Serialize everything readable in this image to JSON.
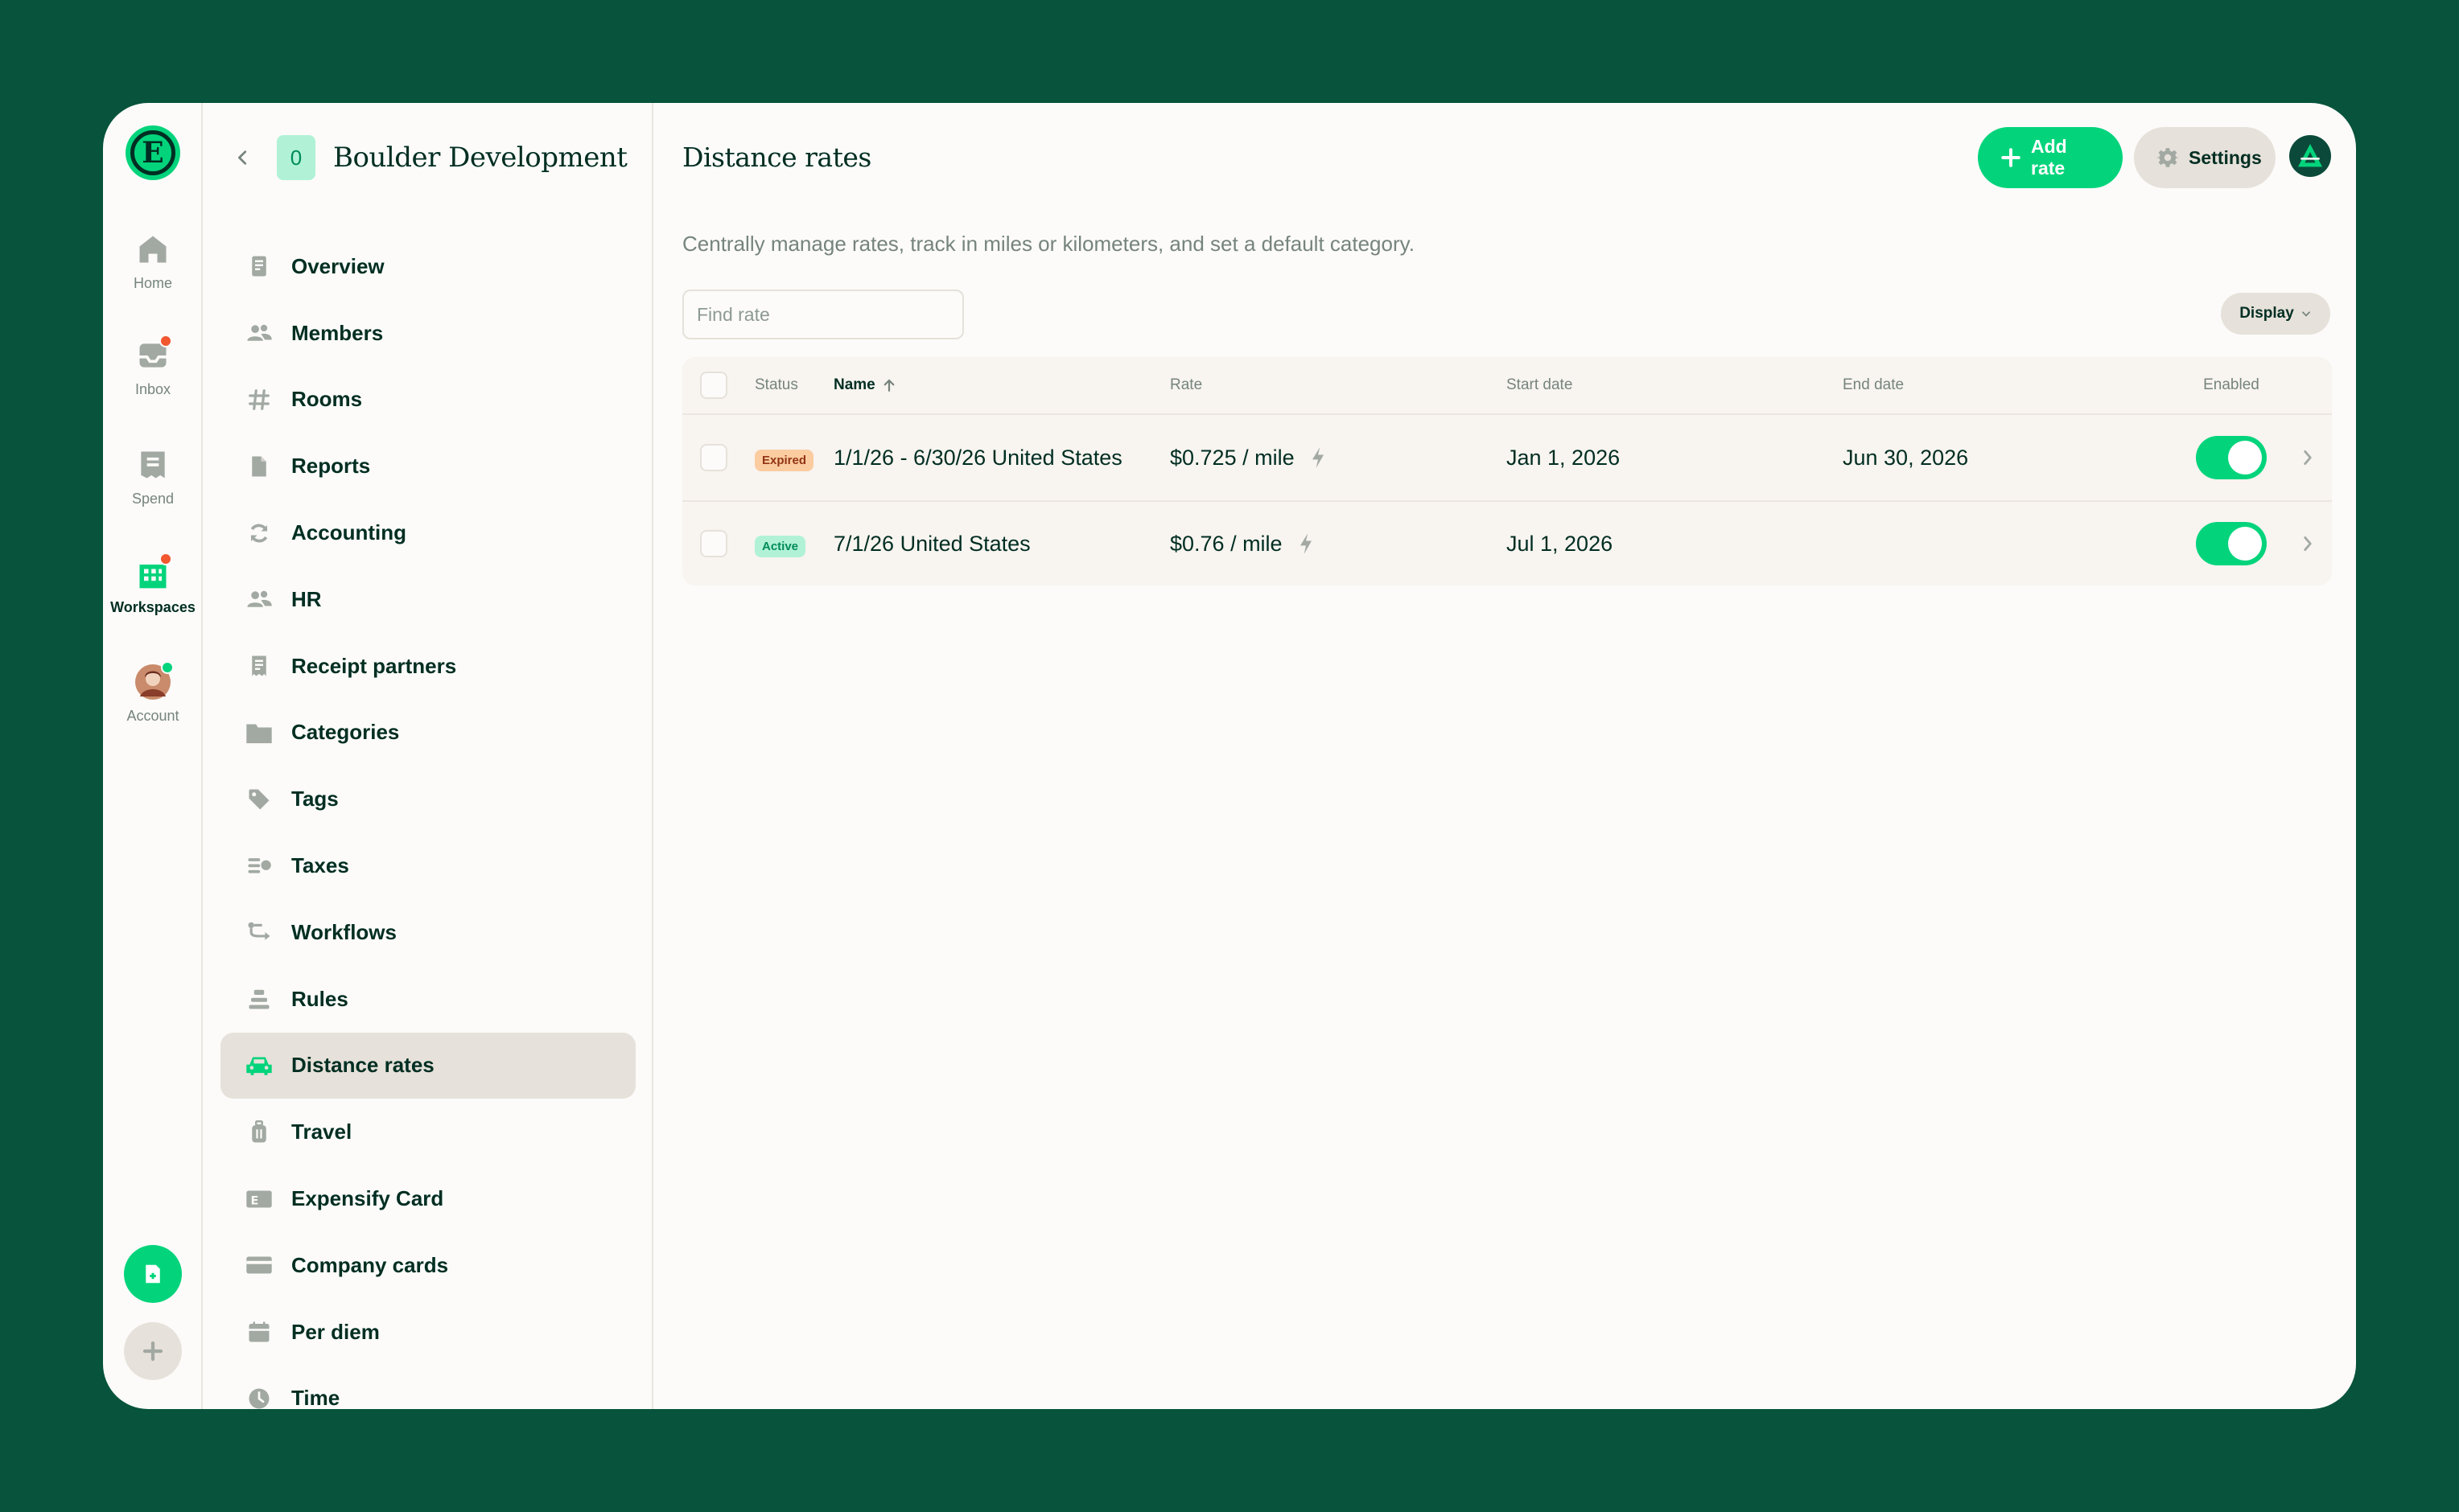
{
  "rail": {
    "items": [
      {
        "label": "Home",
        "icon": "home-icon"
      },
      {
        "label": "Inbox",
        "icon": "inbox-icon"
      },
      {
        "label": "Spend",
        "icon": "receipt-icon"
      },
      {
        "label": "Workspaces",
        "icon": "building-icon"
      },
      {
        "label": "Account",
        "icon": "avatar-icon"
      }
    ]
  },
  "workspace": {
    "badge": "0",
    "name": "Boulder Development"
  },
  "nav": {
    "items": [
      {
        "label": "Overview",
        "icon": "document-icon"
      },
      {
        "label": "Members",
        "icon": "users-icon"
      },
      {
        "label": "Rooms",
        "icon": "hashtag-icon"
      },
      {
        "label": "Reports",
        "icon": "report-icon"
      },
      {
        "label": "Accounting",
        "icon": "sync-icon"
      },
      {
        "label": "HR",
        "icon": "users-icon"
      },
      {
        "label": "Receipt partners",
        "icon": "receipt-icon"
      },
      {
        "label": "Categories",
        "icon": "folder-icon"
      },
      {
        "label": "Tags",
        "icon": "tag-icon"
      },
      {
        "label": "Taxes",
        "icon": "coins-icon"
      },
      {
        "label": "Workflows",
        "icon": "workflow-icon"
      },
      {
        "label": "Rules",
        "icon": "rules-icon"
      },
      {
        "label": "Distance rates",
        "icon": "car-icon"
      },
      {
        "label": "Travel",
        "icon": "luggage-icon"
      },
      {
        "label": "Expensify Card",
        "icon": "expensify-card-icon"
      },
      {
        "label": "Company cards",
        "icon": "credit-card-icon"
      },
      {
        "label": "Per diem",
        "icon": "calendar-icon"
      },
      {
        "label": "Time",
        "icon": "clock-icon"
      }
    ],
    "active": "Distance rates"
  },
  "header": {
    "title": "Distance rates",
    "add_label": "Add rate",
    "settings_label": "Settings"
  },
  "subtitle": "Centrally manage rates, track in miles or kilometers, and set a default category.",
  "search": {
    "placeholder": "Find rate",
    "value": ""
  },
  "display_label": "Display",
  "table": {
    "columns": {
      "status": "Status",
      "name": "Name",
      "rate": "Rate",
      "start": "Start date",
      "end": "End date",
      "enabled": "Enabled"
    },
    "sort": {
      "column": "Name",
      "direction": "ascending"
    },
    "rows": [
      {
        "status": "Expired",
        "name": "1/1/26 - 6/30/26 United States",
        "rate": "$0.725 / mile",
        "start": "Jan 1, 2026",
        "end": "Jun 30, 2026",
        "enabled": true
      },
      {
        "status": "Active",
        "name": "7/1/26 United States",
        "rate": "$0.76 / mile",
        "start": "Jul 1, 2026",
        "end": "",
        "enabled": true
      }
    ]
  },
  "colors": {
    "brand_green": "#03d47c",
    "dark_green": "#002e22",
    "background": "#07533b",
    "expired_badge": "#fbcca0",
    "active_badge": "#b1f2d6"
  }
}
